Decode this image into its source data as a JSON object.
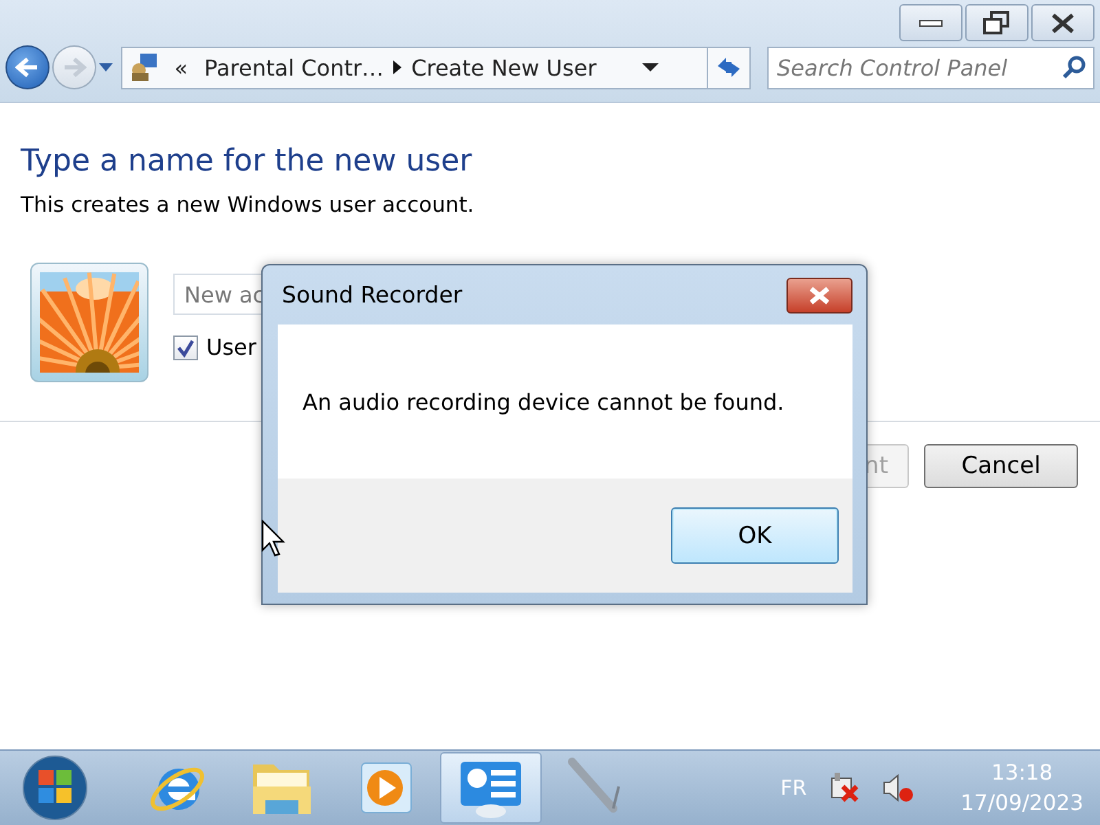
{
  "address_bar": {
    "overflow": "«",
    "crumbs": [
      "Parental Contr…",
      "Create New User"
    ]
  },
  "search": {
    "placeholder": "Search Control Panel"
  },
  "page": {
    "heading": "Type a name for the new user",
    "description": "This creates a new Windows user account.",
    "name_field": {
      "placeholder": "New ac"
    },
    "checkbox": {
      "label": "User",
      "checked": true
    },
    "buttons": [
      {
        "label": "nt",
        "disabled": true
      },
      {
        "label": "Cancel",
        "disabled": false
      }
    ]
  },
  "dialog": {
    "title": "Sound Recorder",
    "message": "An audio recording device cannot be found.",
    "buttons": [
      {
        "label": "OK",
        "default": true
      }
    ]
  },
  "taskbar": {
    "apps": [
      {
        "kind": "browser",
        "selected": false
      },
      {
        "kind": "folder",
        "selected": false
      },
      {
        "kind": "player",
        "selected": false
      },
      {
        "kind": "control-panel",
        "selected": true
      },
      {
        "kind": "microphone",
        "selected": false
      }
    ],
    "language": "FR",
    "clock": {
      "time": "13:18",
      "date": "17/09/2023"
    }
  }
}
